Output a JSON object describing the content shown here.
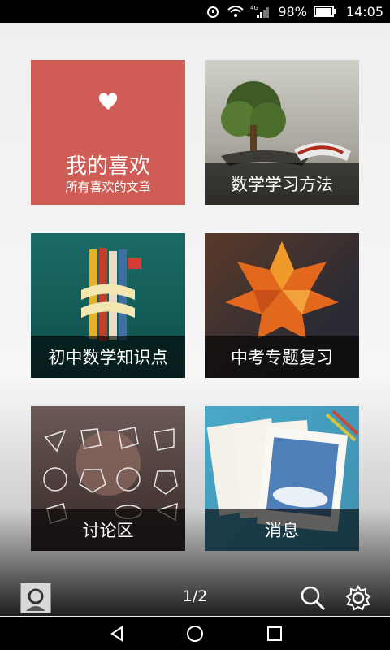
{
  "status_bar": {
    "network": "4G",
    "battery": "98%",
    "time": "14:05"
  },
  "tiles": [
    {
      "label": "我的喜欢",
      "sublabel": "所有喜欢的文章",
      "icon": "heart-icon"
    },
    {
      "label": "数学学习方法"
    },
    {
      "label": "初中数学知识点"
    },
    {
      "label": "中考专题复习"
    },
    {
      "label": "讨论区"
    },
    {
      "label": "消息"
    }
  ],
  "bottom_bar": {
    "pager": "1/2",
    "icons": [
      "avatar",
      "search-icon",
      "settings-icon"
    ]
  },
  "nav_bar": {
    "icons": [
      "back-icon",
      "home-icon",
      "recents-icon"
    ]
  },
  "colors": {
    "favorites_tile": "#d05d55",
    "caption_bg": "rgba(0,0,0,0.62)"
  }
}
